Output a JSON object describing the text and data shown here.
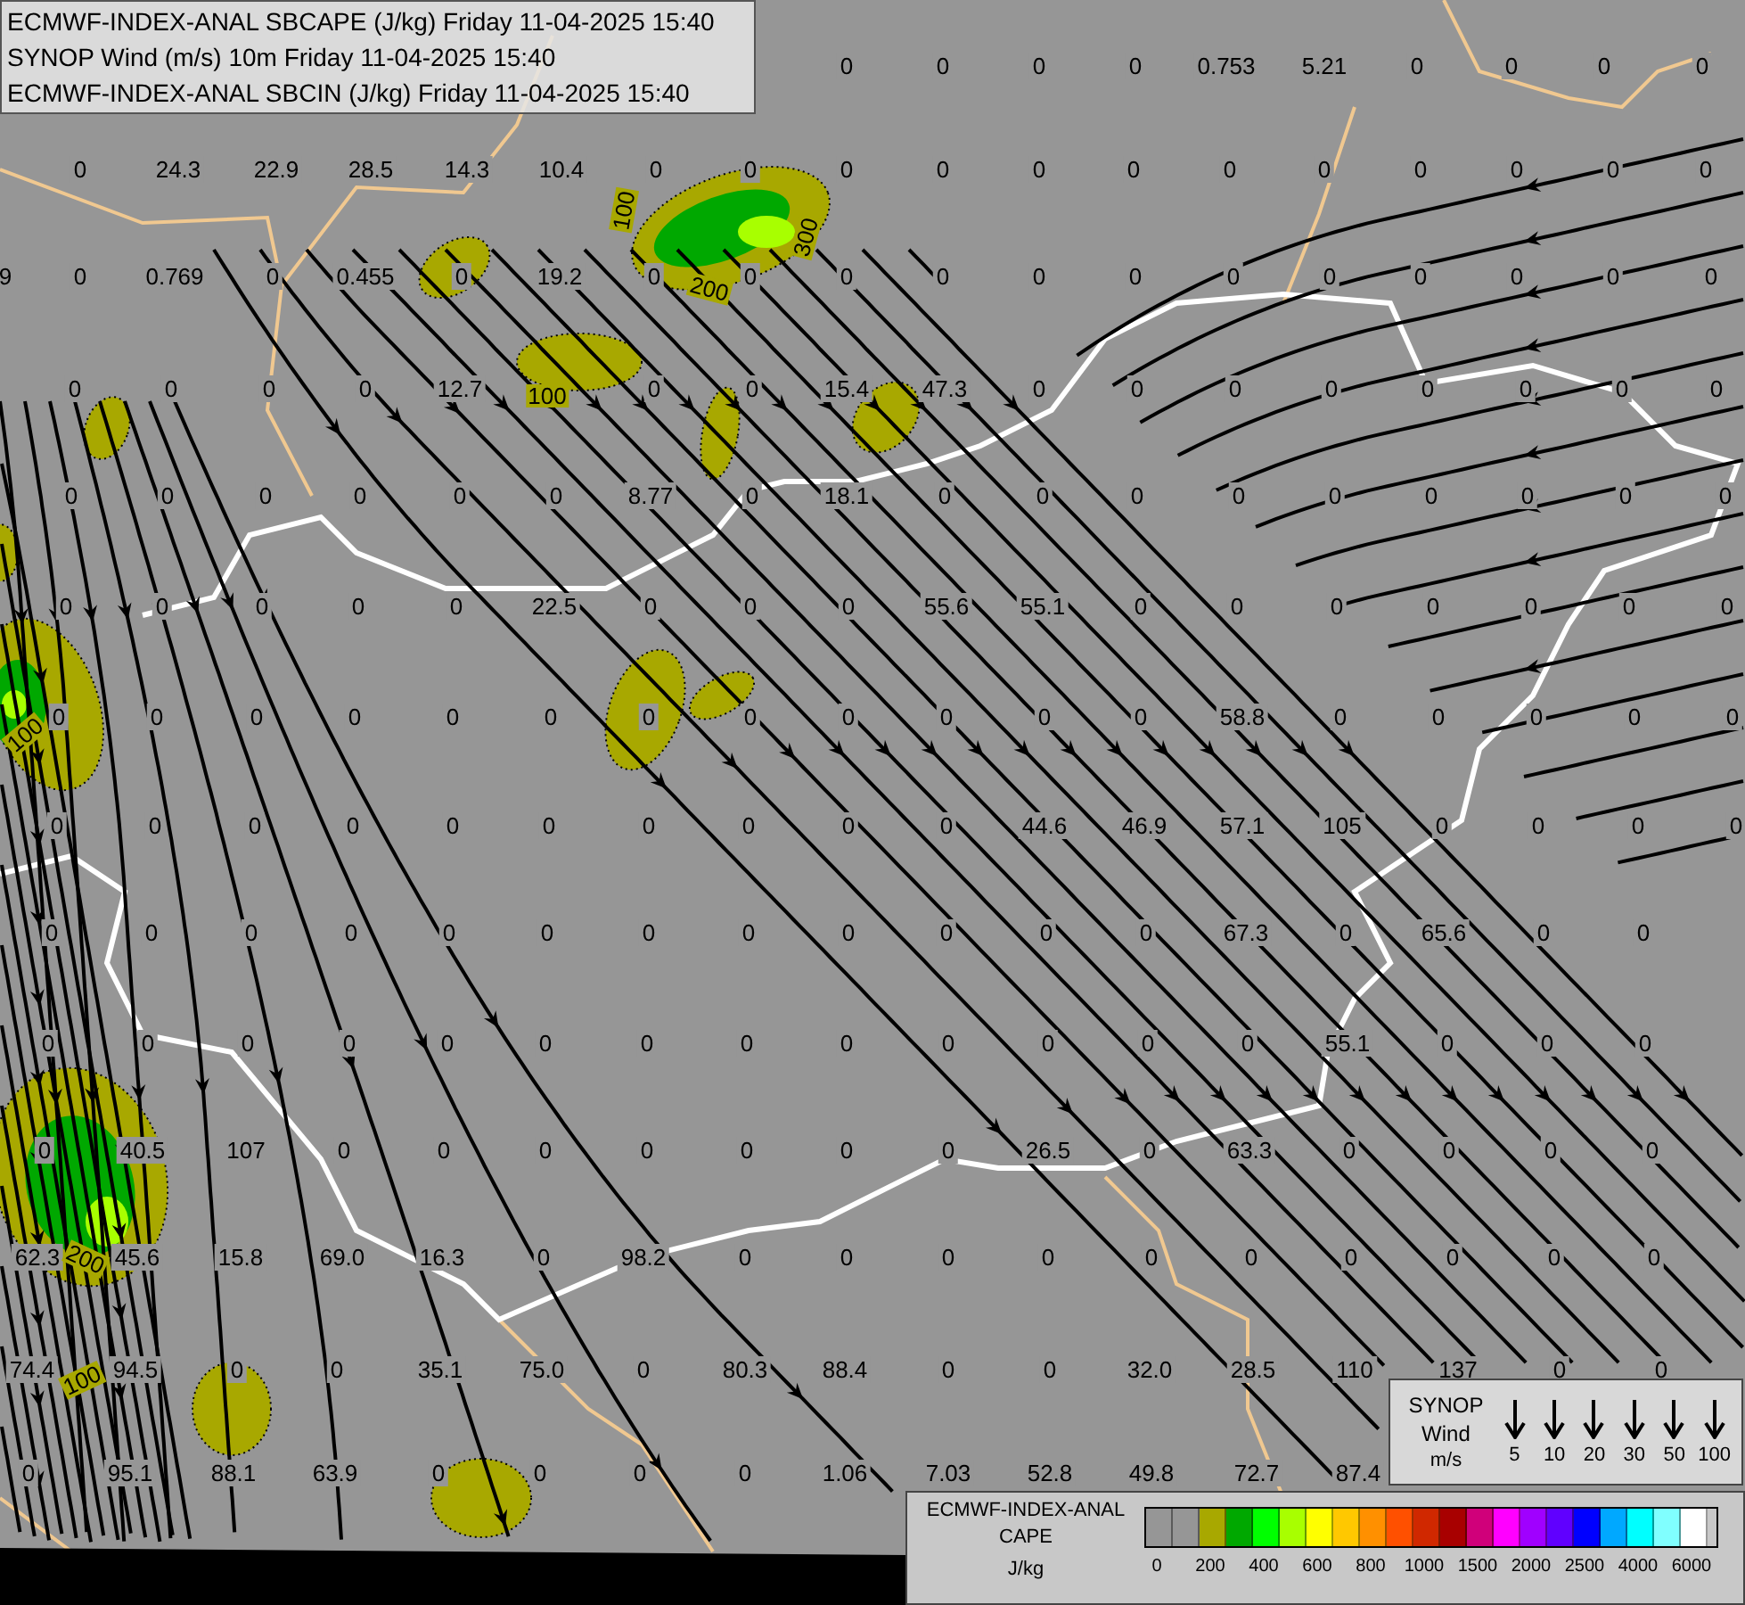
{
  "title_box": {
    "lines": [
      "ECMWF-INDEX-ANAL SBCAPE (J/kg) Friday 11-04-2025 15:40",
      "SYNOP Wind (m/s) 10m Friday 11-04-2025 15:40",
      "ECMWF-INDEX-ANAL SBCIN (J/kg) Friday 11-04-2025 15:40"
    ]
  },
  "map": {
    "value_rows": [
      {
        "values": [
          "0",
          "0",
          "0",
          "0",
          "0.753",
          "5.21",
          "0",
          "0",
          "0",
          "0"
        ]
      },
      {
        "values": [
          "0",
          "24.3",
          "22.9",
          "28.5",
          "14.3",
          "10.4",
          "0",
          "0",
          "0",
          "0",
          "0",
          "0",
          "0",
          "0",
          "0",
          "0",
          "0",
          "0"
        ]
      },
      {
        "values": [
          "9",
          "0",
          "0.769",
          "0",
          "0.455",
          "0",
          "19.2",
          "0",
          "0",
          "0",
          "0",
          "0",
          "0",
          "0",
          "0",
          "0",
          "0",
          "0",
          "0"
        ]
      },
      {
        "values": [
          "0",
          "0",
          "0",
          "0",
          "12.7",
          "0",
          "0",
          "15.4",
          "47.3",
          "0",
          "0",
          "0",
          "0",
          "0",
          "0",
          "0",
          "0"
        ]
      },
      {
        "values": [
          "0",
          "0",
          "0",
          "0",
          "0",
          "0",
          "8.77",
          "0",
          "18.1",
          "0",
          "0",
          "0",
          "0",
          "0",
          "0",
          "0",
          "0",
          "0"
        ]
      },
      {
        "values": [
          "0",
          "0",
          "0",
          "0",
          "0",
          "22.5",
          "0",
          "0",
          "0",
          "55.6",
          "55.1",
          "0",
          "0",
          "0",
          "0",
          "0",
          "0",
          "0"
        ]
      },
      {
        "values": [
          "0",
          "0",
          "0",
          "0",
          "0",
          "0",
          "0",
          "0",
          "0",
          "0",
          "0",
          "0",
          "58.8",
          "0",
          "0",
          "0",
          "0",
          "0"
        ]
      },
      {
        "values": [
          "0",
          "0",
          "0",
          "0",
          "0",
          "0",
          "0",
          "0",
          "0",
          "0",
          "44.6",
          "46.9",
          "57.1",
          "105",
          "0",
          "0",
          "0",
          "0"
        ]
      },
      {
        "values": [
          "0",
          "0",
          "0",
          "0",
          "0",
          "0",
          "0",
          "0",
          "0",
          "0",
          "0",
          "0",
          "67.3",
          "0",
          "65.6",
          "0",
          "0"
        ]
      },
      {
        "values": [
          "0",
          "0",
          "0",
          "0",
          "0",
          "0",
          "0",
          "0",
          "0",
          "0",
          "0",
          "0",
          "0",
          "55.1",
          "0",
          "0",
          "0"
        ]
      },
      {
        "values": [
          "0",
          "40.5",
          "107",
          "0",
          "0",
          "0",
          "0",
          "0",
          "0",
          "0",
          "26.5",
          "0",
          "63.3",
          "0",
          "0",
          "0",
          "0"
        ]
      },
      {
        "values": [
          "62.3",
          "45.6",
          "15.8",
          "69.0",
          "16.3",
          "0",
          "98.2",
          "0",
          "0",
          "0",
          "0",
          "0",
          "0",
          "0",
          "0",
          "0",
          "0"
        ]
      },
      {
        "values": [
          "74.4",
          "94.5",
          "0",
          "0",
          "35.1",
          "75.0",
          "0",
          "80.3",
          "88.4",
          "0",
          "0",
          "32.0",
          "28.5",
          "110",
          "137",
          "0",
          "0"
        ]
      },
      {
        "values": [
          "0",
          "95.1",
          "88.1",
          "63.9",
          "0",
          "0",
          "0",
          "0",
          "1.06",
          "7.03",
          "52.8",
          "49.8",
          "72.7",
          "87.4"
        ]
      }
    ],
    "contour_labels": [
      "100",
      "200",
      "300",
      "100",
      "100",
      "200",
      "100"
    ]
  },
  "wind_legend": {
    "title_lines": [
      "SYNOP",
      "Wind"
    ],
    "unit": "m/s",
    "speeds": [
      "5",
      "10",
      "20",
      "30",
      "50",
      "100"
    ]
  },
  "cape_legend": {
    "title_lines": [
      "ECMWF-INDEX-ANAL",
      "CAPE"
    ],
    "unit": "J/kg",
    "swatches": [
      {
        "color": "#969696"
      },
      {
        "color": "#969696"
      },
      {
        "color": "#a8a800"
      },
      {
        "color": "#00a800"
      },
      {
        "color": "#00ff00"
      },
      {
        "color": "#a8ff00"
      },
      {
        "color": "#ffff00"
      },
      {
        "color": "#ffc800"
      },
      {
        "color": "#ff9000"
      },
      {
        "color": "#ff5000"
      },
      {
        "color": "#d02800"
      },
      {
        "color": "#a80000"
      },
      {
        "color": "#d0007a"
      },
      {
        "color": "#ff00ff"
      },
      {
        "color": "#a000ff"
      },
      {
        "color": "#6000ff"
      },
      {
        "color": "#0000ff"
      },
      {
        "color": "#00a8ff"
      },
      {
        "color": "#00ffff"
      },
      {
        "color": "#80ffff"
      },
      {
        "color": "#ffffff"
      }
    ],
    "tick_labels": [
      "0",
      "200",
      "400",
      "600",
      "800",
      "1000",
      "1500",
      "2000",
      "2500",
      "4000",
      "6000"
    ]
  }
}
